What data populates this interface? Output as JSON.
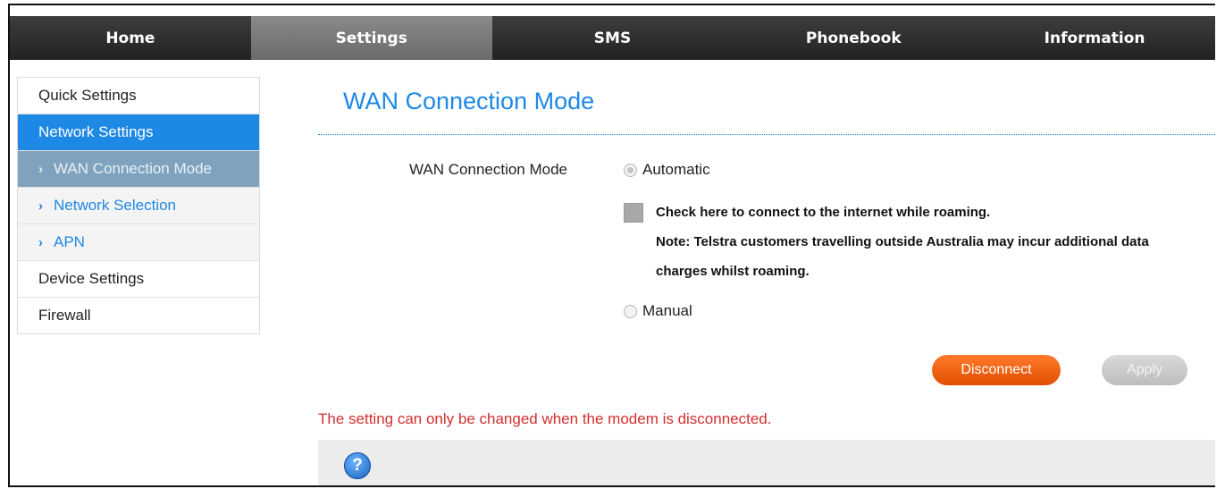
{
  "nav": {
    "items": [
      "Home",
      "Settings",
      "SMS",
      "Phonebook",
      "Information"
    ],
    "active": "Settings"
  },
  "sidebar": {
    "items": [
      {
        "label": "Quick Settings",
        "type": "top"
      },
      {
        "label": "Network Settings",
        "type": "top",
        "active": true
      },
      {
        "label": "WAN Connection Mode",
        "type": "sub",
        "active": true
      },
      {
        "label": "Network Selection",
        "type": "sub"
      },
      {
        "label": "APN",
        "type": "sub"
      },
      {
        "label": "Device Settings",
        "type": "top"
      },
      {
        "label": "Firewall",
        "type": "top"
      }
    ],
    "sub_chevron": "›"
  },
  "page": {
    "title": "WAN Connection Mode",
    "field_label": "WAN Connection Mode",
    "option_automatic": "Automatic",
    "automatic_selected": true,
    "roaming_checkbox_label": "Check here to connect to the internet while roaming.",
    "roaming_checked": false,
    "roaming_note_line1": "Note: Telstra customers travelling outside Australia may incur additional data",
    "roaming_note_line2": "charges whilst roaming.",
    "option_manual": "Manual",
    "manual_selected": false,
    "disconnect_label": "Disconnect",
    "apply_label": "Apply",
    "warning": "The setting can only be changed when the modem is disconnected.",
    "help_glyph": "?"
  },
  "colors": {
    "accent": "#1e88e5",
    "nav_bg": "#2b2b2b",
    "nav_active": "#7a7a7a",
    "disconnect": "#f26a1b",
    "warning": "#d32f2f"
  },
  "icons": [
    "chevron-right-icon",
    "help-icon"
  ]
}
